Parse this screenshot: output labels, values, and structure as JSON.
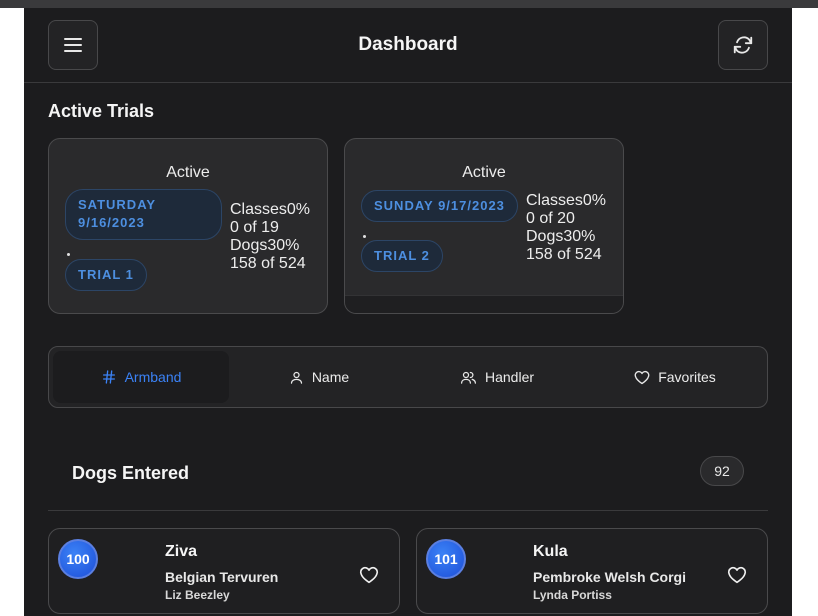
{
  "header": {
    "title": "Dashboard",
    "menu_icon": "hamburger-menu-icon",
    "refresh_icon": "refresh-icon"
  },
  "active_trials": {
    "section_title": "Active Trials",
    "cards": [
      {
        "status": "Active",
        "date": "SATURDAY 9/16/2023",
        "date_line1": "SATURDAY",
        "date_line2": "9/16/2023",
        "trial": "TRIAL 1",
        "classes_line": "Classes0%",
        "classes_count": "0 of 19",
        "dogs_line": "Dogs30%",
        "dogs_count": "158 of 524"
      },
      {
        "status": "Active",
        "date": "SUNDAY 9/17/2023",
        "trial": "TRIAL 2",
        "classes_line": "Classes0%",
        "classes_count": "0 of 20",
        "dogs_line": "Dogs30%",
        "dogs_count": "158 of 524"
      }
    ]
  },
  "tabs": [
    {
      "label": "Armband",
      "icon": "hash-icon",
      "active": true
    },
    {
      "label": "Name",
      "icon": "person-icon",
      "active": false
    },
    {
      "label": "Handler",
      "icon": "people-icon",
      "active": false
    },
    {
      "label": "Favorites",
      "icon": "heart-icon",
      "active": false
    }
  ],
  "dogs_entered": {
    "title": "Dogs Entered",
    "count": "92"
  },
  "dogs": [
    {
      "armband": "100",
      "name": "Ziva",
      "breed": "Belgian Tervuren",
      "handler": "Liz Beezley"
    },
    {
      "armband": "101",
      "name": "Kula",
      "breed": "Pembroke Welsh Corgi",
      "handler": "Lynda Portiss"
    }
  ],
  "colors": {
    "background": "#1c1c1e",
    "accent": "#3b82f6",
    "pill_text": "#4d8fe0",
    "card_border": "#4a4a4c"
  }
}
